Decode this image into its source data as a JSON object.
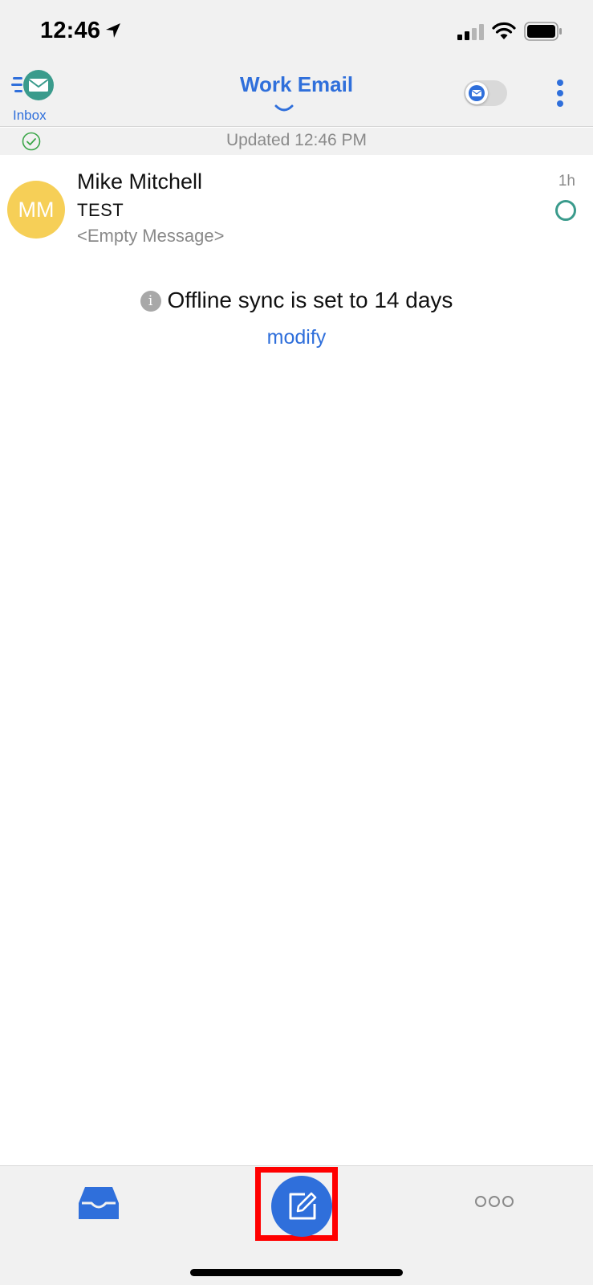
{
  "status_bar": {
    "time": "12:46"
  },
  "header": {
    "inbox_label": "Inbox",
    "title": "Work Email"
  },
  "sync_status": {
    "updated_text": "Updated 12:46 PM"
  },
  "messages": [
    {
      "initials": "MM",
      "sender": "Mike Mitchell",
      "subject": "TEST",
      "preview": "<Empty Message>",
      "age": "1h",
      "avatar_color": "#f6cf57"
    }
  ],
  "offline_notice": {
    "text": "Offline sync is set to 14 days",
    "action": "modify"
  },
  "colors": {
    "accent": "#2f6fdb",
    "unread": "#3a9b8c",
    "highlight": "#ff0000"
  },
  "tab_bar": {
    "icons": [
      "inbox-tray-icon",
      "compose-icon",
      "more-icon"
    ]
  }
}
